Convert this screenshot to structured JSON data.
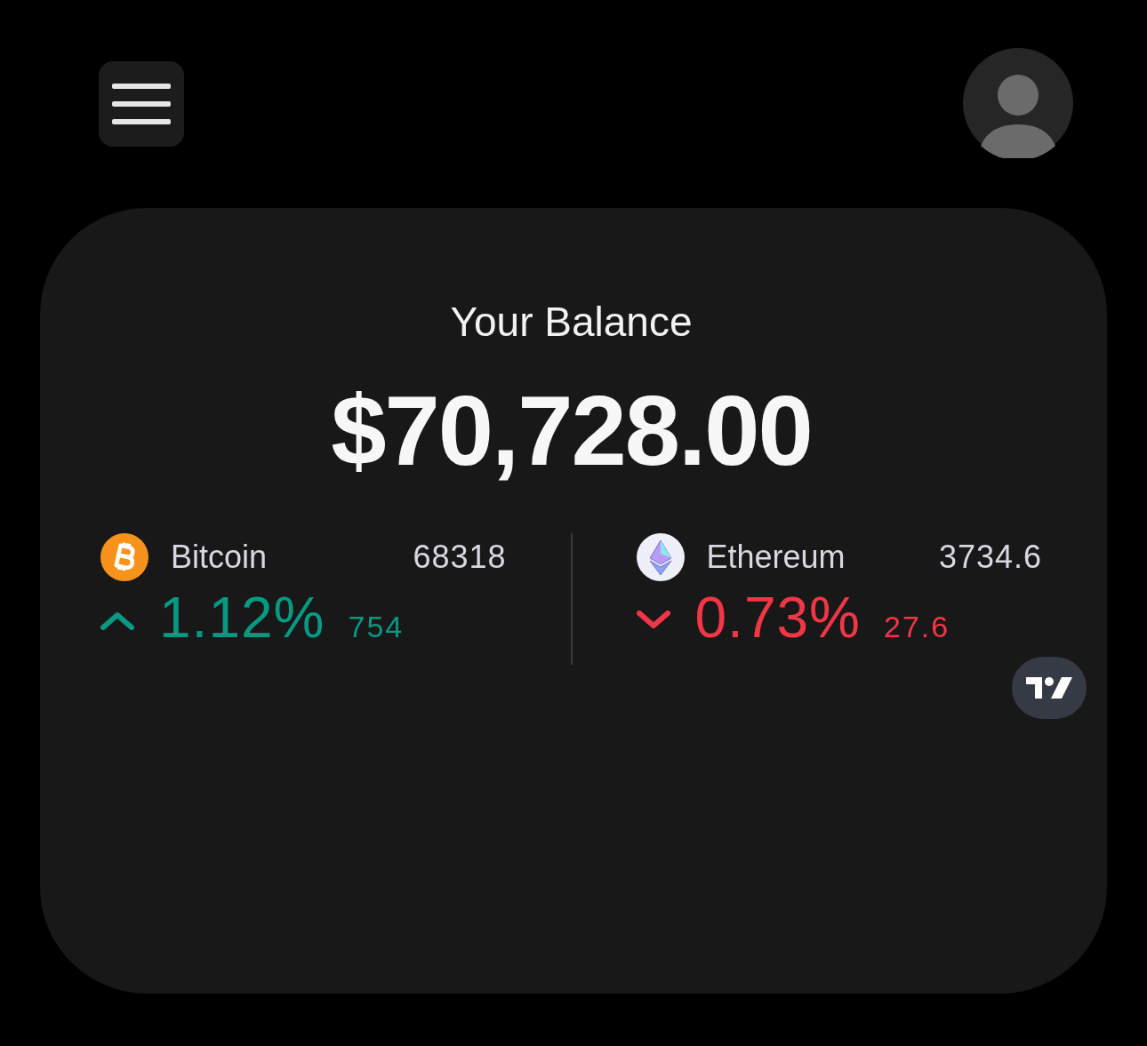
{
  "balance": {
    "label": "Your Balance",
    "amount": "$70,728.00"
  },
  "tickers": [
    {
      "icon": {
        "kind": "bitcoin"
      },
      "name": "Bitcoin",
      "price": "68318",
      "delta": {
        "kind": "up",
        "percent": "1.12%",
        "value": "754"
      }
    },
    {
      "icon": {
        "kind": "ethereum"
      },
      "name": "Ethereum",
      "price": "3734.6",
      "delta": {
        "kind": "down",
        "percent": "0.73%",
        "value": "27.6"
      }
    }
  ]
}
